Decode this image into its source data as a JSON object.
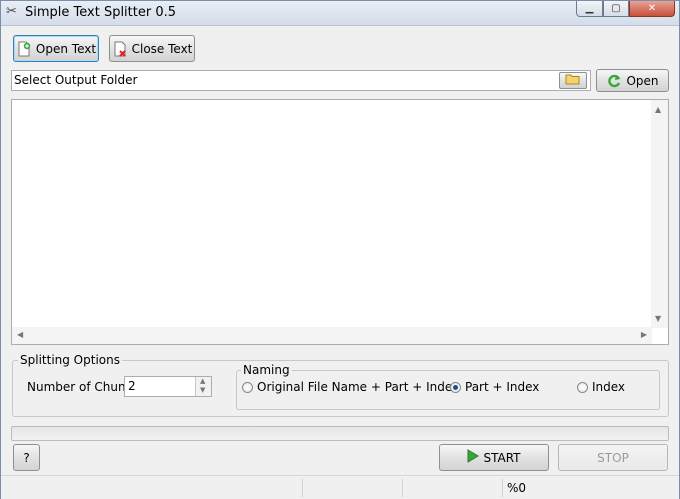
{
  "window": {
    "title": "Simple Text Splitter 0.5"
  },
  "toolbar": {
    "open_text": "Open Text",
    "close_text": "Close Text"
  },
  "output": {
    "folder_label": "Select Output Folder",
    "open_label": "Open"
  },
  "options": {
    "group_label": "Splitting Options",
    "chunks_label": "Number of Chunks:",
    "chunks_value": "2",
    "naming": {
      "label": "Naming",
      "opt1": "Original File Name + Part + Index",
      "opt2": "Part + Index",
      "opt3": "Index",
      "selected": "Part + Index"
    }
  },
  "progress": {
    "value": 0
  },
  "actions": {
    "help": "?",
    "start": "START",
    "stop": "STOP"
  },
  "status": {
    "percent": "%0"
  },
  "colors": {
    "accent": "#3c7fb1",
    "start_icon": "#3aa53a"
  }
}
